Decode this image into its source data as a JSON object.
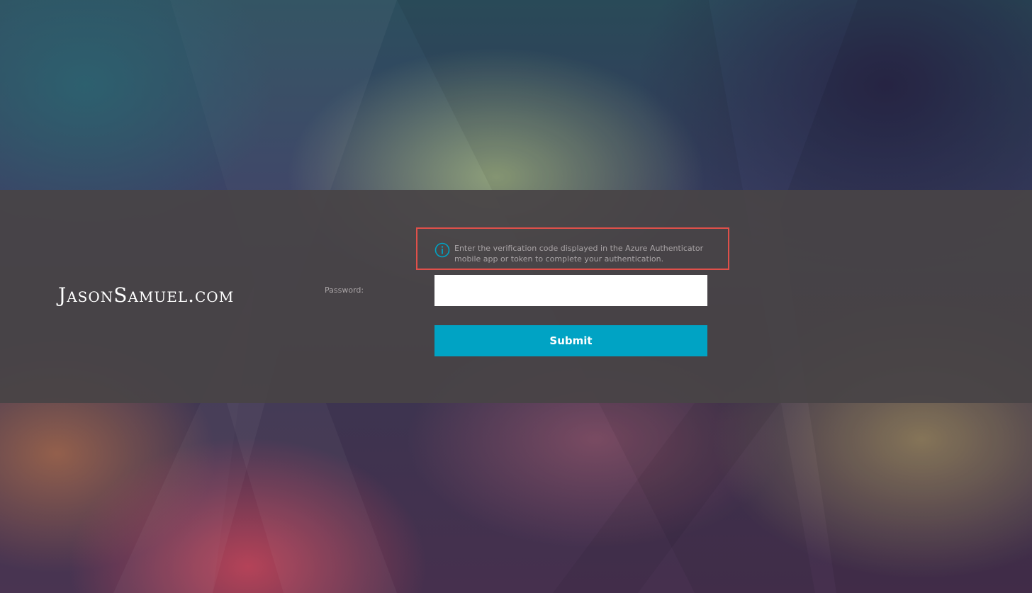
{
  "brand": {
    "logo_text": "JasonSamuel.com"
  },
  "notice": {
    "icon": "info-icon",
    "text": "Enter the verification code displayed in the Azure Authenticator mobile app or token to complete your authentication.",
    "highlight_color": "#e0504a",
    "icon_color": "#00a3c4"
  },
  "form": {
    "password_label": "Password:",
    "password_value": "",
    "password_placeholder": "",
    "submit_label": "Submit"
  },
  "colors": {
    "accent": "#00a3c4",
    "band": "#484446"
  }
}
